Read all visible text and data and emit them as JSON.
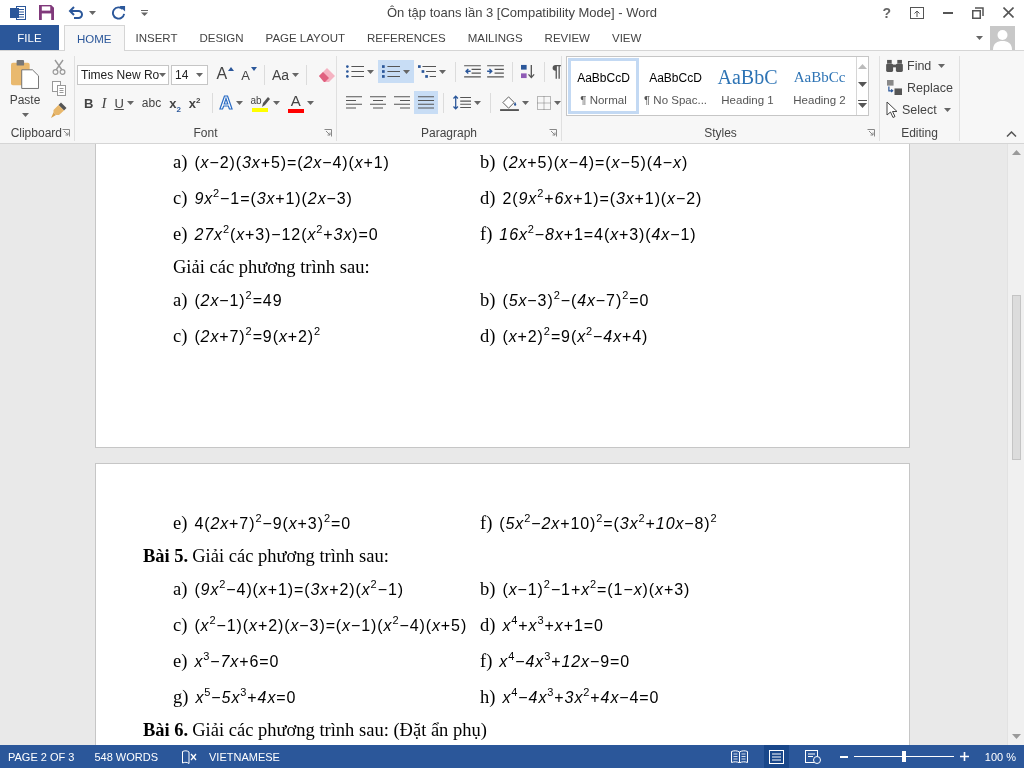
{
  "title_bar": {
    "title": "Ôn tập toans lần 3 [Compatibility Mode] - Word",
    "help": "?"
  },
  "tabs": [
    {
      "label": "FILE",
      "kind": "file",
      "selected": false
    },
    {
      "label": "HOME",
      "kind": "tab",
      "selected": true
    },
    {
      "label": "INSERT",
      "kind": "tab",
      "selected": false
    },
    {
      "label": "DESIGN",
      "kind": "tab",
      "selected": false
    },
    {
      "label": "PAGE LAYOUT",
      "kind": "tab",
      "selected": false
    },
    {
      "label": "REFERENCES",
      "kind": "tab",
      "selected": false
    },
    {
      "label": "MAILINGS",
      "kind": "tab",
      "selected": false
    },
    {
      "label": "REVIEW",
      "kind": "tab",
      "selected": false
    },
    {
      "label": "VIEW",
      "kind": "tab",
      "selected": false
    }
  ],
  "ribbon": {
    "clipboard": {
      "label": "Clipboard",
      "paste": "Paste"
    },
    "font": {
      "label": "Font",
      "font_name": "Times New Ro",
      "font_size": "14",
      "grow": "A",
      "shrink": "A",
      "change_case": "Aa",
      "formats": [
        {
          "kind": "bold",
          "glyph": "B"
        },
        {
          "kind": "italic",
          "glyph": "I"
        },
        {
          "kind": "underline",
          "glyph": "U"
        },
        {
          "kind": "strikethrough",
          "glyph": "abc"
        },
        {
          "kind": "subscript",
          "glyph": "x$_{2}$"
        },
        {
          "kind": "superscript",
          "glyph": "x$^{2}$"
        }
      ],
      "text_effects": "A",
      "highlight": "ab",
      "font_color": "A"
    },
    "paragraph": {
      "label": "Paragraph",
      "lists": [
        {
          "kind": "bullets",
          "on": false
        },
        {
          "kind": "numbering",
          "on": true
        },
        {
          "kind": "multilevel",
          "on": false
        }
      ],
      "alignments": [
        {
          "kind": "left",
          "on": false
        },
        {
          "kind": "center",
          "on": false
        },
        {
          "kind": "right",
          "on": false
        },
        {
          "kind": "justify",
          "on": true
        }
      ],
      "show_marks": "¶"
    },
    "styles": {
      "label": "Styles",
      "items": [
        {
          "kind": "normal",
          "preview": "AaBbCcD",
          "name": "¶ Normal",
          "selected": true
        },
        {
          "kind": "normal",
          "preview": "AaBbCcD",
          "name": "¶ No Spac...",
          "selected": false
        },
        {
          "kind": "heading1",
          "preview": "AaBbC",
          "name": "Heading 1",
          "selected": false
        },
        {
          "kind": "heading2",
          "preview": "AaBbCc",
          "name": "Heading 2",
          "selected": false
        }
      ]
    },
    "editing": {
      "label": "Editing",
      "items": [
        {
          "kind": "find",
          "label": "Find"
        },
        {
          "kind": "replace",
          "label": "Replace"
        },
        {
          "kind": "select",
          "label": "Select"
        }
      ]
    }
  },
  "document": {
    "pages": [
      {
        "blocks": [
          {
            "kind": "pair",
            "items": [
              {
                "label": "a)",
                "expr": "(*x*−2)(*3x*+5)=(*2x*−4)(*x*+1)"
              },
              {
                "label": "b)",
                "expr": "(*2x*+5)(*x*−4)=(*x*−5)(4−*x*)"
              }
            ]
          },
          {
            "kind": "pair",
            "items": [
              {
                "label": "c)",
                "expr": "*9x*$^{2}$−1=(*3x*+1)(*2x*−3)"
              },
              {
                "label": "d)",
                "expr": "2(*9x*$^{2}$+*6x*+1)=(*3x*+1)(*x*−2)"
              }
            ]
          },
          {
            "kind": "pair",
            "items": [
              {
                "label": "e)",
                "expr": "*27x*$^{2}$(*x*+3)−12(*x*$^{2}$+*3x*)=0"
              },
              {
                "label": "f)",
                "expr": "*16x*$^{2}$−*8x*+1=4(*x*+3)(*4x*−1)"
              }
            ]
          },
          {
            "kind": "instruction",
            "text": "Giải các phương trình sau:"
          },
          {
            "kind": "pair",
            "items": [
              {
                "label": "a)",
                "expr": "(*2x*−1)$^{2}$=49"
              },
              {
                "label": "b)",
                "expr": "(*5x*−3)$^{2}$−(*4x*−7)$^{2}$=0"
              }
            ]
          },
          {
            "kind": "pair",
            "items": [
              {
                "label": "c)",
                "expr": "(*2x*+7)$^{2}$=9(*x*+2)$^{2}$"
              },
              {
                "label": "d)",
                "expr": "(*x*+2)$^{2}$=9(*x*$^{2}$−*4x*+4)"
              }
            ]
          }
        ]
      },
      {
        "blocks": [
          {
            "kind": "pair",
            "items": [
              {
                "label": "e)",
                "expr": "4(*2x*+7)$^{2}$−9(*x*+3)$^{2}$=0"
              },
              {
                "label": "f)",
                "expr": "(*5x*$^{2}$−*2x*+10)$^{2}$=(*3x*$^{2}$+*10x*−8)$^{2}$"
              }
            ]
          },
          {
            "kind": "exercise",
            "number": "Bài 5.",
            "text": "Giải các phương trình sau:"
          },
          {
            "kind": "pair",
            "items": [
              {
                "label": "a)",
                "expr": "(*9x*$^{2}$−4)(*x*+1)=(*3x*+2)(*x*$^{2}$−1)"
              },
              {
                "label": "b)",
                "expr": "(*x*−1)$^{2}$−1+*x*$^{2}$=(1−*x*)(*x*+3)"
              }
            ]
          },
          {
            "kind": "pair",
            "items": [
              {
                "label": "c)",
                "expr": "(*x*$^{2}$−1)(*x*+2)(*x*−3)=(*x*−1)(*x*$^{2}$−4)(*x*+5)"
              },
              {
                "label": "d)",
                "expr": "*x*$^{4}$+*x*$^{3}$+*x*+1=0"
              }
            ]
          },
          {
            "kind": "pair",
            "items": [
              {
                "label": "e)",
                "expr": "*x*$^{3}$−*7x*+6=0"
              },
              {
                "label": "f)",
                "expr": "*x*$^{4}$−*4x*$^{3}$+*12x*−9=0"
              }
            ]
          },
          {
            "kind": "pair",
            "items": [
              {
                "label": "g)",
                "expr": "*x*$^{5}$−*5x*$^{3}$+*4x*=0"
              },
              {
                "label": "h)",
                "expr": "*x*$^{4}$−*4x*$^{3}$+*3x*$^{2}$+*4x*−4=0"
              }
            ]
          },
          {
            "kind": "exercise",
            "number": "Bài 6.",
            "text": "Giải các phương trình sau: (Đặt ẩn phụ)"
          }
        ]
      }
    ]
  },
  "status_bar": {
    "page": "PAGE 2 OF 3",
    "words": "548 WORDS",
    "language": "VIETNAMESE",
    "views": [
      {
        "kind": "read",
        "selected": false
      },
      {
        "kind": "print",
        "selected": true
      },
      {
        "kind": "web",
        "selected": false
      }
    ],
    "zoom": {
      "level": 0.5,
      "reading": "100 %"
    }
  }
}
